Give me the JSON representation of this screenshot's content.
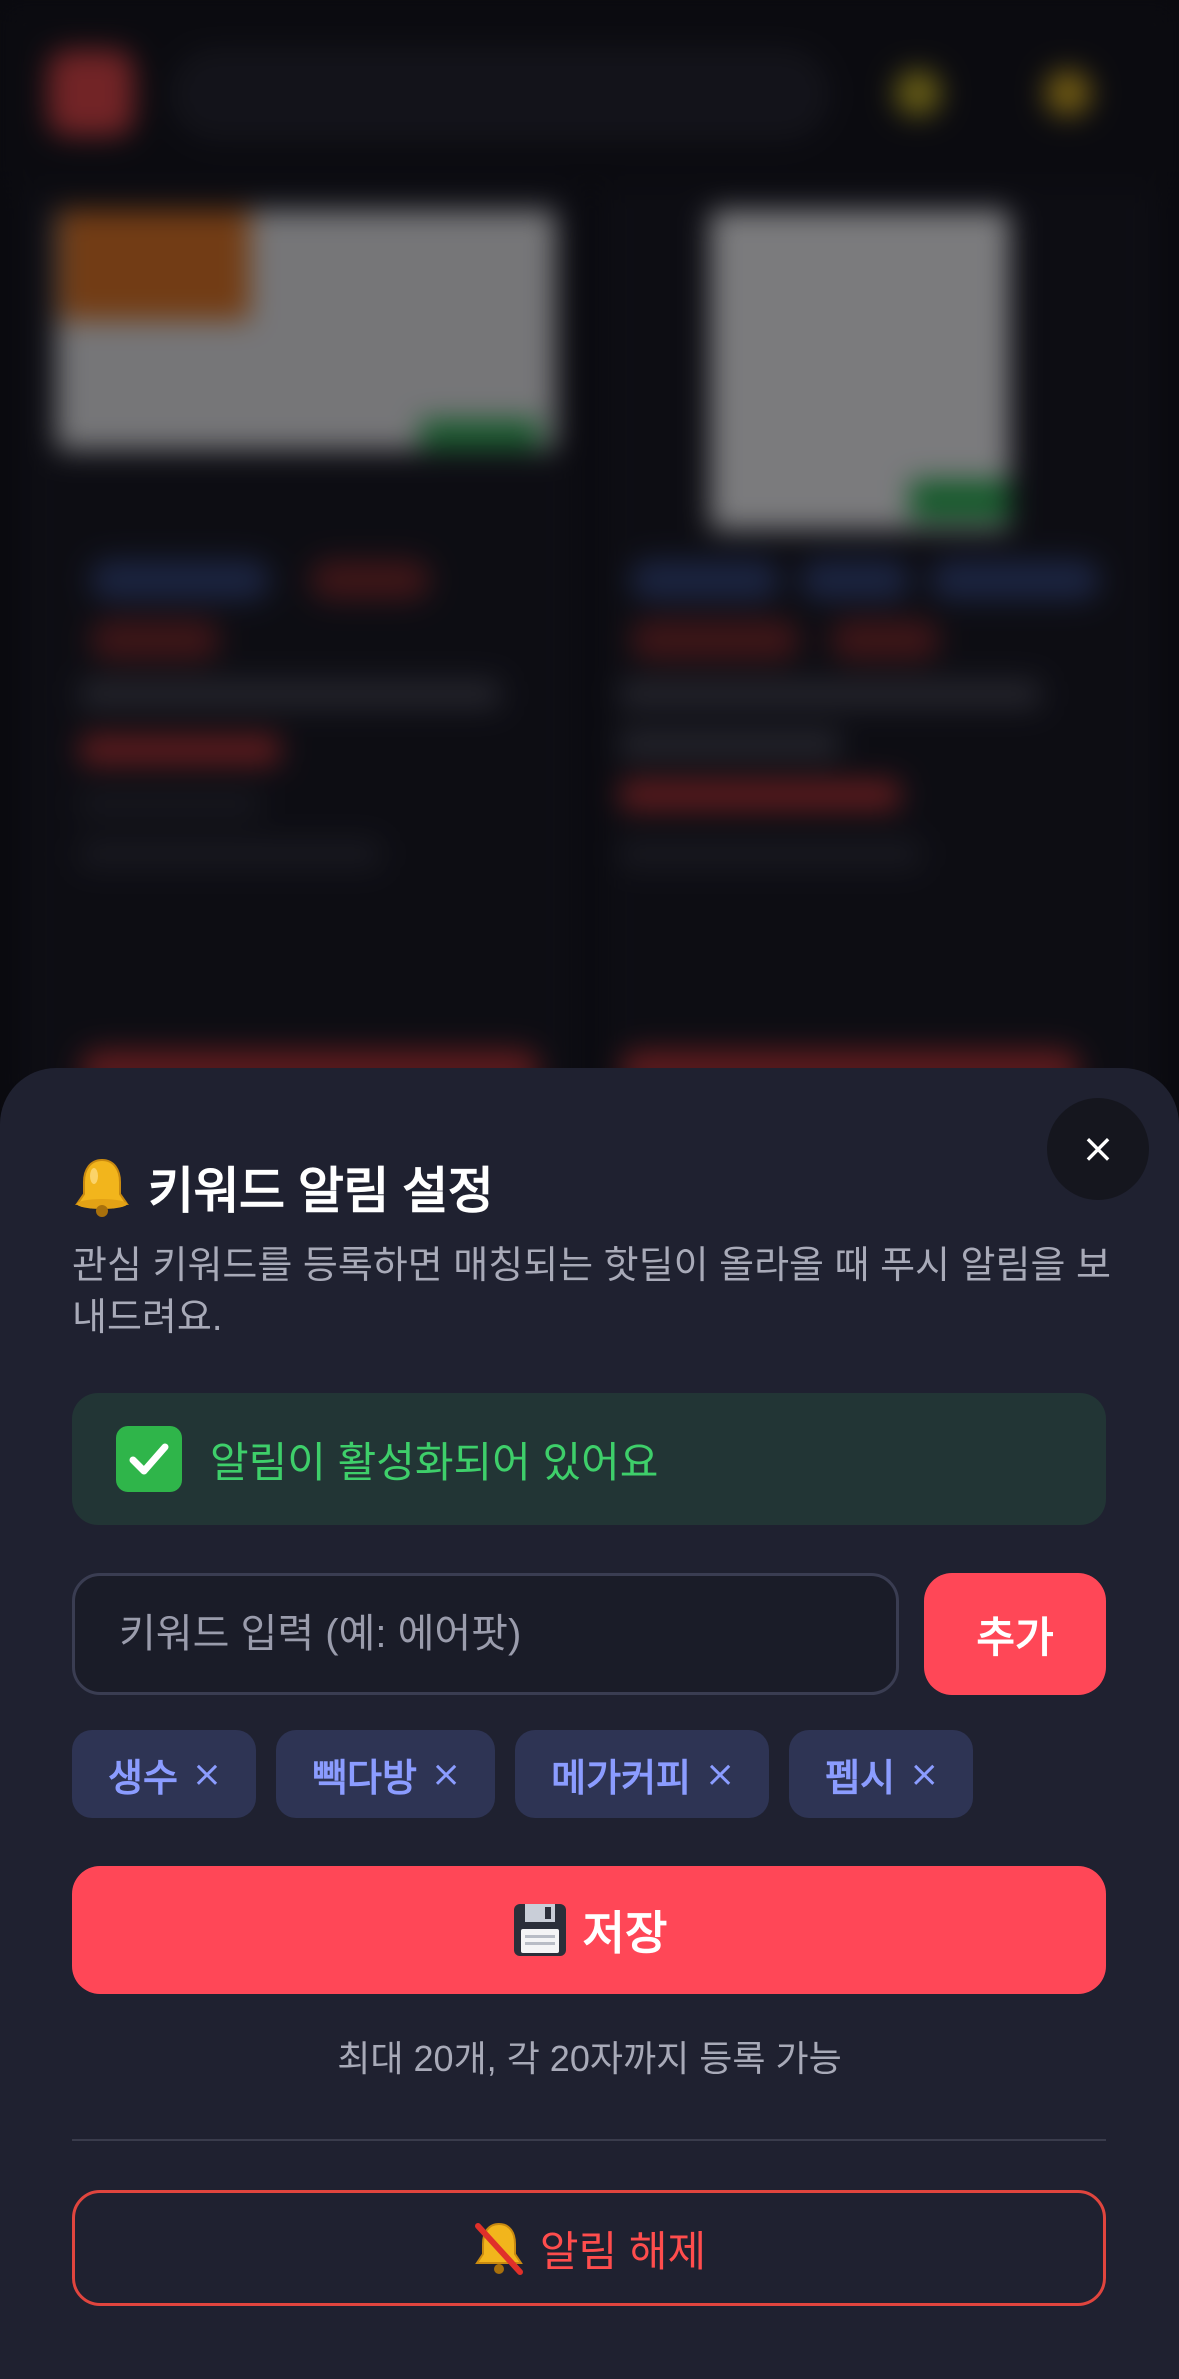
{
  "sheet": {
    "title": "키워드 알림 설정",
    "title_icon": "bell-icon",
    "subtitle": "관심 키워드를 등록하면 매칭되는 핫딜이 올라올 때 푸시 알림을 보내드려요.",
    "close_label": "×",
    "status": {
      "icon": "check-mark-icon",
      "text": "알림이 활성화되어 있어요",
      "color": "#3ecf6a"
    },
    "keyword_input": {
      "placeholder": "키워드 입력 (예: 에어팟)",
      "value": ""
    },
    "add_label": "추가",
    "keywords": [
      {
        "label": "생수",
        "remove": "×"
      },
      {
        "label": "빽다방",
        "remove": "×"
      },
      {
        "label": "메가커피",
        "remove": "×"
      },
      {
        "label": "펩시",
        "remove": "×"
      }
    ],
    "save": {
      "icon": "floppy-disk-icon",
      "label": "저장"
    },
    "hint": "최대 20개, 각 20자까지 등록 가능",
    "disable": {
      "icon": "muted-bell-icon",
      "label": "알림 해제"
    }
  },
  "colors": {
    "accent": "#ff4757",
    "sheet_bg": "#1f2130",
    "chip_bg": "#2e3454",
    "chip_text": "#8b9cff",
    "danger": "#ff4d4d"
  }
}
